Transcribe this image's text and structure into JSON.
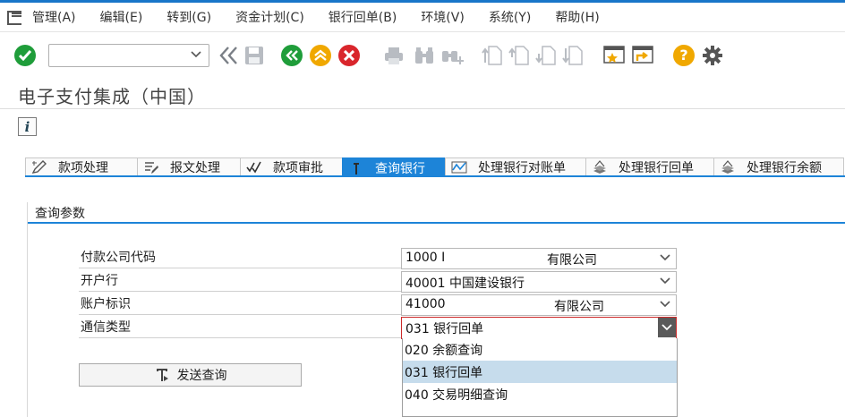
{
  "menu": {
    "items": [
      "管理(A)",
      "编辑(E)",
      "转到(G)",
      "资金计划(C)",
      "银行回单(B)",
      "环境(V)",
      "系统(Y)",
      "帮助(H)"
    ]
  },
  "toolbar": {
    "command_value": "",
    "icons": [
      "enter-check-icon",
      "command-field",
      "double-left-chevron-icon",
      "save-icon",
      "back-icon",
      "exit-icon",
      "cancel-icon",
      "print-icon",
      "find-icon",
      "find-next-icon",
      "first-page-icon",
      "previous-page-icon",
      "next-page-icon",
      "last-page-icon",
      "create-session-icon",
      "shortcut-icon",
      "help-icon",
      "settings-gear-icon"
    ],
    "colors": {
      "green": "#1f9d3a",
      "yellow": "#f0a800",
      "red": "#d9262c",
      "blue": "#1d84d8"
    }
  },
  "page": {
    "title": "电子支付集成（中国）",
    "info_glyph": "i"
  },
  "tabs": [
    {
      "label": "款项处理",
      "icon": "pencil-icon",
      "active": false
    },
    {
      "label": "报文处理",
      "icon": "document-edit-icon",
      "active": false
    },
    {
      "label": "款项审批",
      "icon": "double-check-icon",
      "active": false
    },
    {
      "label": "查询银行",
      "icon": "query-bank-icon",
      "active": true
    },
    {
      "label": "处理银行对账单",
      "icon": "statement-chart-icon",
      "active": false
    },
    {
      "label": "处理银行回单",
      "icon": "receipt-stack-icon",
      "active": false
    },
    {
      "label": "处理银行余额",
      "icon": "balance-stack-icon",
      "active": false
    }
  ],
  "group": {
    "title": "查询参数",
    "fields": [
      {
        "label": "付款公司代码",
        "value": "1000 I",
        "desc": "有限公司"
      },
      {
        "label": "开户行",
        "value": "40001 中国建设银行",
        "desc": ""
      },
      {
        "label": "账户标识",
        "value": "41000",
        "desc": "有限公司"
      },
      {
        "label": "通信类型",
        "value": "031 银行回单",
        "desc": ""
      }
    ],
    "dropdown_options": [
      {
        "label": "020 余额查询",
        "selected": false
      },
      {
        "label": "031 银行回单",
        "selected": true
      },
      {
        "label": "040 交易明细查询",
        "selected": false
      }
    ],
    "send_button": "发送查询"
  }
}
